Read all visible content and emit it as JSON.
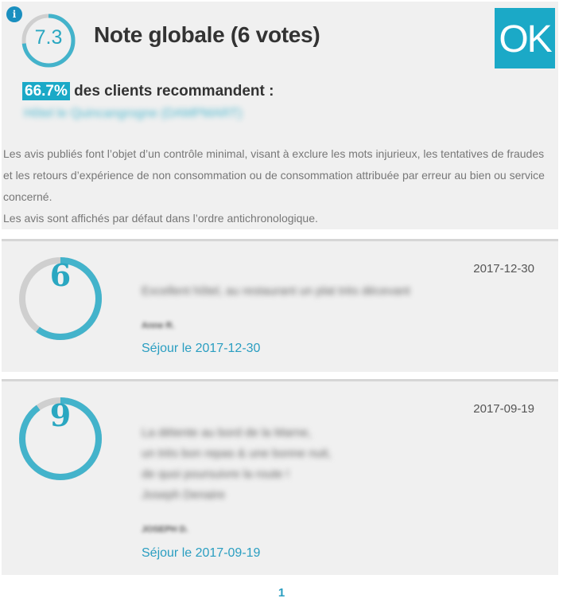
{
  "summary": {
    "info_icon": "info-icon",
    "score": "7.3",
    "score_fraction": 0.73,
    "title": "Note globale (6 votes)",
    "badge": "OK",
    "recommend_pct": "66.7%",
    "recommend_text": "des clients recommandent :",
    "hotel_link": "Hôtel le Quincangrogne (DAMPMART)",
    "disclaimer": "Les avis publiés font l’objet d’un contrôle minimal, visant à exclure les mots injurieux, les tentatives de fraudes et les retours d’expérience de non consommation ou de consommation attribuée par erreur au bien ou service concerné.",
    "order_note": "Les avis sont affichés par défaut dans l’ordre antichronologique."
  },
  "reviews": [
    {
      "score": "6",
      "score_fraction": 0.6,
      "date": "2017-12-30",
      "text": [
        "Excellent hôtel, au restaurant un plat très décevant"
      ],
      "author": "Anne R.",
      "stay": "Séjour le 2017-12-30"
    },
    {
      "score": "9",
      "score_fraction": 0.9,
      "date": "2017-09-19",
      "text": [
        "La détente au bord de la Marne,",
        "un très bon repas & une bonne nuit,",
        "de quoi poursuivre la route !",
        "Joseph Denaire"
      ],
      "author": "JOSEPH D.",
      "stay": "Séjour le 2017-09-19"
    }
  ],
  "pagination": {
    "current": "1"
  },
  "colors": {
    "accent": "#1ba9c7",
    "ring_fill": "#43b3cb",
    "ring_track": "#cfcfcf",
    "panel": "#f0f0f0"
  }
}
